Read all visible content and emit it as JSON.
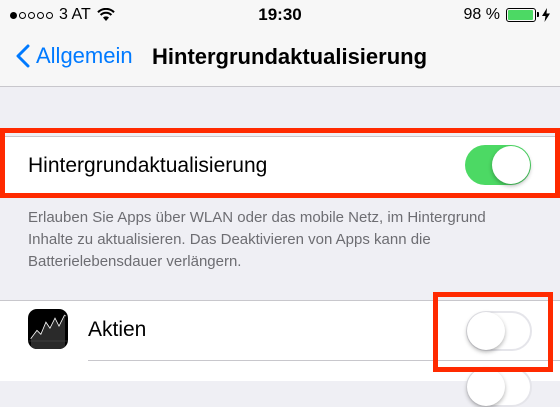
{
  "status_bar": {
    "carrier": "3 AT",
    "time": "19:30",
    "battery_percent": "98 %",
    "battery_level": 0.98,
    "signal_bars": 1
  },
  "nav": {
    "back_label": "Allgemein",
    "title": "Hintergrundaktualisierung"
  },
  "master": {
    "label": "Hintergrundaktualisierung",
    "enabled": true
  },
  "footer": "Erlauben Sie Apps über WLAN oder das mobile Netz, im Hintergrund Inhalte zu aktualisieren. Das Deaktivieren von Apps kann die Batterielebensdauer verlängern.",
  "apps": [
    {
      "name": "Aktien",
      "enabled": false,
      "icon": "stocks-icon"
    }
  ],
  "colors": {
    "accent": "#007aff",
    "toggle_on": "#4cd964",
    "highlight": "#ff2a00"
  }
}
